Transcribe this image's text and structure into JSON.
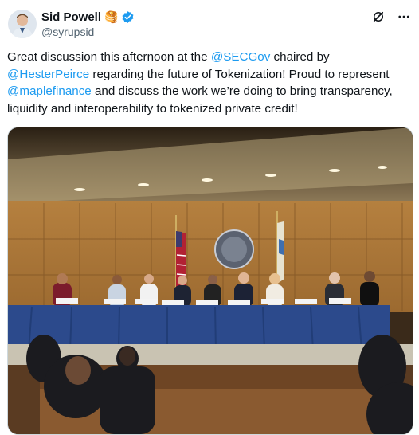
{
  "author": {
    "name": "Sid Powell",
    "emoji": "🥞",
    "handle": "@syrupsid"
  },
  "tweet": {
    "seg1": "Great discussion this afternoon at the ",
    "mention1": "@SECGov",
    "seg2": " chaired by ",
    "mention2": "@HesterPeirce",
    "seg3": " regarding the future of Tokenization! Proud to represent ",
    "mention3": "@maplefinance",
    "seg4": " and discuss the work we’re doing to bring transparency, liquidity and interoperability to tokenized private credit!"
  },
  "icons": {
    "verified": "verified-badge-icon",
    "grok": "grok-icon",
    "more": "more-icon"
  },
  "colors": {
    "link": "#1d9bf0",
    "text": "#0f1419",
    "secondary": "#536471",
    "verified": "#1d9bf0"
  }
}
